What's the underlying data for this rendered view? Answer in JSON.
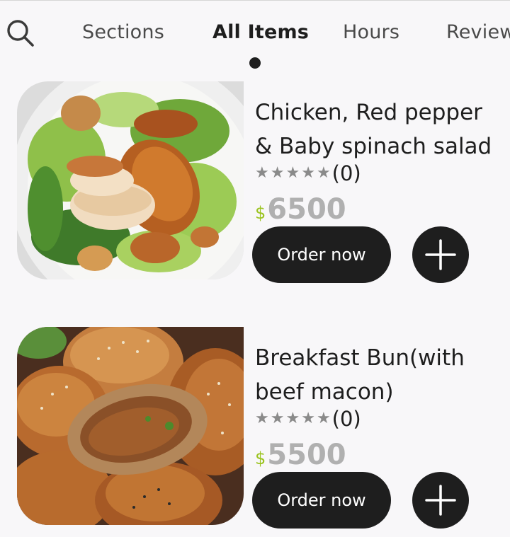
{
  "tabs": [
    {
      "label": "Sections",
      "active": false
    },
    {
      "label": "All Items",
      "active": true
    },
    {
      "label": "Hours",
      "active": false
    },
    {
      "label": "Reviews",
      "active": false
    }
  ],
  "icons": {
    "search": "search-icon",
    "add": "plus-icon",
    "star": "star-icon"
  },
  "colors": {
    "background": "#f8f7f9",
    "primary": "#1e1e1e",
    "currency": "#9bc320",
    "price": "#b0b0b0",
    "star": "#8a8a8a"
  },
  "items": [
    {
      "title": "Chicken, Red pepper & Baby spinach salad",
      "rating_count": "(0)",
      "rating_stars": 0,
      "currency": "$",
      "price": "6500",
      "order_label": "Order now",
      "image": "roast-chicken-salad"
    },
    {
      "title": "Breakfast Bun(with beef macon)",
      "rating_count": "(0)",
      "rating_stars": 0,
      "currency": "$",
      "price": "5500",
      "order_label": "Order now",
      "image": "stuffed-sesame-buns"
    }
  ]
}
